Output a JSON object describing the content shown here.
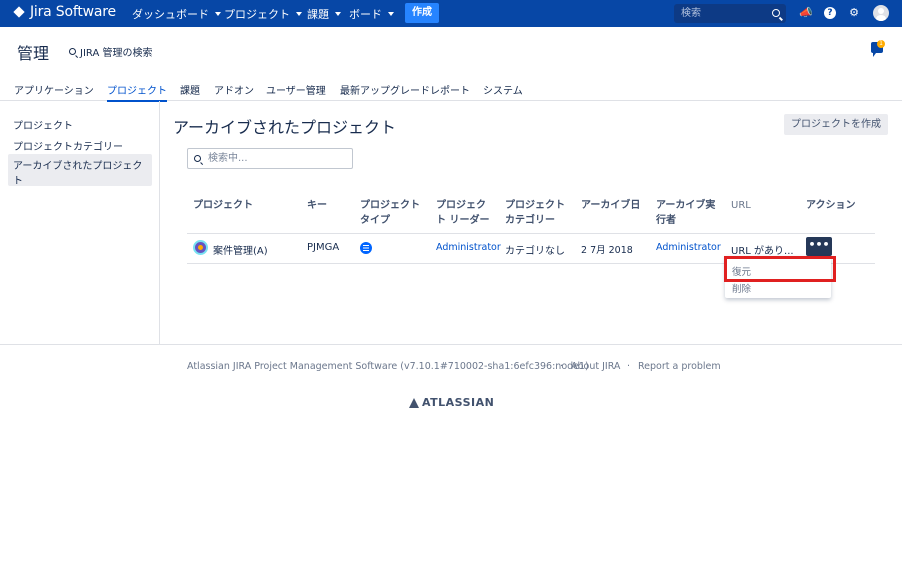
{
  "topnav": {
    "brand": "Jira Software",
    "items": [
      "ダッシュボード",
      "プロジェクト",
      "課題",
      "ボード"
    ],
    "create_label": "作成",
    "search_placeholder": "検索"
  },
  "admin": {
    "title": "管理",
    "search_label": "JIRA 管理の検索",
    "notification_count": "1"
  },
  "tabs": [
    "アプリケーション",
    "プロジェクト",
    "課題",
    "アドオン",
    "ユーザー管理",
    "最新アップグレードレポート",
    "システム"
  ],
  "sidebar": {
    "items": [
      "プロジェクト",
      "プロジェクトカテゴリー",
      "アーカイブされたプロジェクト"
    ]
  },
  "main": {
    "title": "アーカイブされたプロジェクト",
    "create_button": "プロジェクトを作成",
    "search_placeholder": "検索中..."
  },
  "table": {
    "headers": {
      "project": "プロジェクト",
      "key": "キー",
      "type_line1": "プロジェクト",
      "type_line2": "タイプ",
      "lead_line1": "プロジェク",
      "lead_line2": "ト リーダー",
      "category_line1": "プロジェクト",
      "category_line2": "カテゴリー",
      "archived_date": "アーカイブ日",
      "archived_by_line1": "アーカイブ実",
      "archived_by_line2": "行者",
      "url": "URL",
      "actions": "アクション"
    },
    "rows": [
      {
        "project": "案件管理(A)",
        "key": "PJMGA",
        "lead": "Administrator",
        "category": "カテゴリなし",
        "archived_date": "2 7月 2018",
        "archived_by": "Administrator",
        "url": "URL があり..."
      }
    ],
    "more_label": "•••"
  },
  "dropdown": {
    "items": [
      "復元",
      "削除"
    ]
  },
  "footer": {
    "version": "Atlassian JIRA Project Management Software (v7.10.1#710002-sha1:6efc396:node1)",
    "sep": "·",
    "about": "About JIRA",
    "report": "Report a problem",
    "logo_text": "ATLASSIAN"
  },
  "colors": {
    "nav_bg": "#0747a6",
    "accent": "#0052cc",
    "create_btn": "#2684ff",
    "highlight": "#e02020"
  }
}
